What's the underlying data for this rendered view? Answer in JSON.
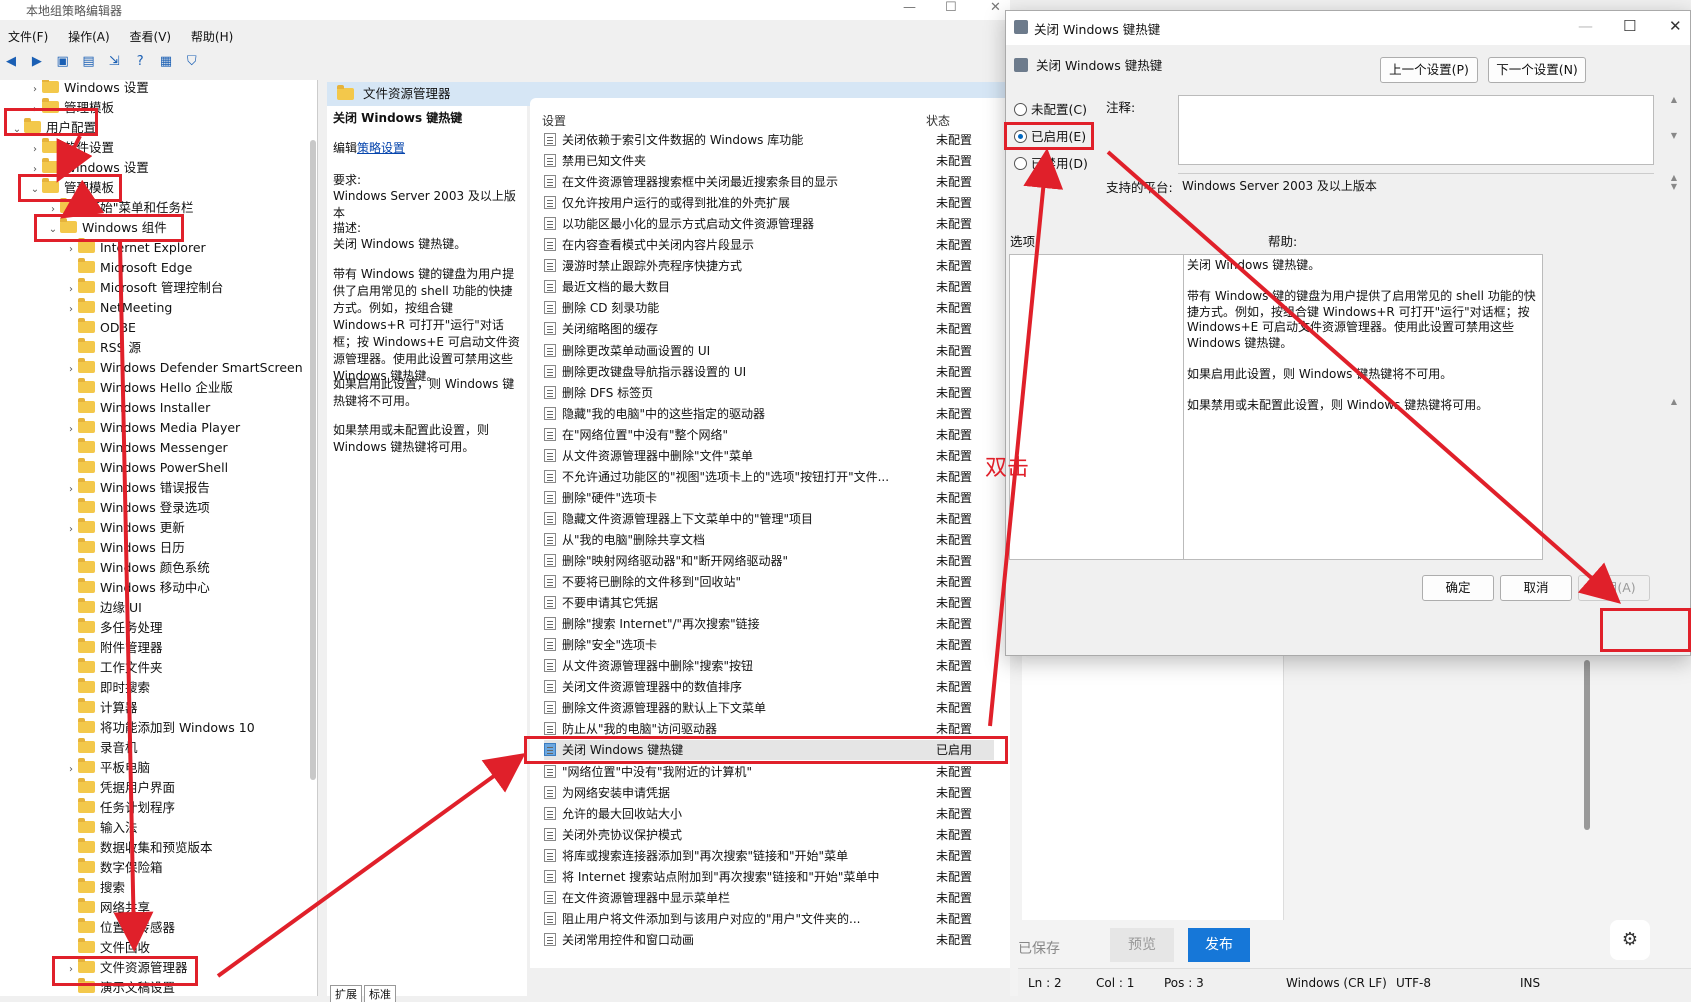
{
  "window": {
    "title": "本地组策略编辑器"
  },
  "menu": [
    "文件(F)",
    "操作(A)",
    "查看(V)",
    "帮助(H)"
  ],
  "toolbar_icons": [
    "back-icon",
    "forward-icon",
    "up-folder-icon",
    "show-hide-icon",
    "export-icon",
    "help-icon",
    "properties-icon",
    "filter-icon"
  ],
  "tree": [
    {
      "label": "Windows 设置",
      "expander": "›"
    },
    {
      "label": "管理模板",
      "expander": "›"
    },
    {
      "label": "用户配置",
      "expander": "⌄"
    },
    {
      "label": "软件设置",
      "expander": "›"
    },
    {
      "label": "Windows 设置",
      "expander": "›"
    },
    {
      "label": "管理模板",
      "expander": "⌄"
    },
    {
      "label": "\"开始\"菜单和任务栏",
      "expander": "›"
    },
    {
      "label": "Windows 组件",
      "expander": "⌄"
    },
    {
      "label": "Internet Explorer",
      "expander": "›"
    },
    {
      "label": "Microsoft Edge",
      "expander": ""
    },
    {
      "label": "Microsoft 管理控制台",
      "expander": "›"
    },
    {
      "label": "NetMeeting",
      "expander": "›"
    },
    {
      "label": "ODBE",
      "expander": ""
    },
    {
      "label": "RSS 源",
      "expander": ""
    },
    {
      "label": "Windows Defender SmartScreen",
      "expander": "›"
    },
    {
      "label": "Windows Hello 企业版",
      "expander": ""
    },
    {
      "label": "Windows Installer",
      "expander": ""
    },
    {
      "label": "Windows Media Player",
      "expander": "›"
    },
    {
      "label": "Windows Messenger",
      "expander": ""
    },
    {
      "label": "Windows PowerShell",
      "expander": ""
    },
    {
      "label": "Windows 错误报告",
      "expander": "›"
    },
    {
      "label": "Windows 登录选项",
      "expander": ""
    },
    {
      "label": "Windows 更新",
      "expander": "›"
    },
    {
      "label": "Windows 日历",
      "expander": ""
    },
    {
      "label": "Windows 颜色系统",
      "expander": ""
    },
    {
      "label": "Windows 移动中心",
      "expander": ""
    },
    {
      "label": "边缘 UI",
      "expander": ""
    },
    {
      "label": "多任务处理",
      "expander": ""
    },
    {
      "label": "附件管理器",
      "expander": ""
    },
    {
      "label": "工作文件夹",
      "expander": ""
    },
    {
      "label": "即时搜索",
      "expander": ""
    },
    {
      "label": "计算器",
      "expander": ""
    },
    {
      "label": "将功能添加到 Windows 10",
      "expander": ""
    },
    {
      "label": "录音机",
      "expander": ""
    },
    {
      "label": "平板电脑",
      "expander": "›"
    },
    {
      "label": "凭据用户界面",
      "expander": ""
    },
    {
      "label": "任务计划程序",
      "expander": ""
    },
    {
      "label": "输入法",
      "expander": ""
    },
    {
      "label": "数据收集和预览版本",
      "expander": ""
    },
    {
      "label": "数字保险箱",
      "expander": ""
    },
    {
      "label": "搜索",
      "expander": ""
    },
    {
      "label": "网络共享",
      "expander": ""
    },
    {
      "label": "位置和传感器",
      "expander": ""
    },
    {
      "label": "文件回收",
      "expander": ""
    },
    {
      "label": "文件资源管理器",
      "expander": "›"
    },
    {
      "label": "演示文稿设置",
      "expander": ""
    }
  ],
  "desc": {
    "header": "文件资源管理器",
    "title": "关闭 Windows 键热键",
    "edit_prefix": "编辑",
    "edit_link": "策略设置",
    "req_label": "要求:",
    "req_value": "Windows Server 2003 及以上版本",
    "desc_label": "描述:",
    "desc_p1": "关闭 Windows 键热键。",
    "desc_p2": "带有 Windows 键的键盘为用户提供了启用常见的 shell 功能的快捷方式。例如，按组合键 Windows+R 可打开\"运行\"对话框；按 Windows+E 可启动文件资源管理器。使用此设置可禁用这些 Windows 键热键。",
    "desc_p3": "如果启用此设置，则 Windows 键热键将不可用。",
    "desc_p4": "如果禁用或未配置此设置，则 Windows 键热键将可用。"
  },
  "settings": {
    "col_setting": "设置",
    "col_state": "状态",
    "rows": [
      {
        "name": "关闭依赖于索引文件数据的 Windows 库功能",
        "state": "未配置"
      },
      {
        "name": "禁用已知文件夹",
        "state": "未配置"
      },
      {
        "name": "在文件资源管理器搜索框中关闭最近搜索条目的显示",
        "state": "未配置"
      },
      {
        "name": "仅允许按用户运行的或得到批准的外壳扩展",
        "state": "未配置"
      },
      {
        "name": "以功能区最小化的显示方式启动文件资源管理器",
        "state": "未配置"
      },
      {
        "name": "在内容查看模式中关闭内容片段显示",
        "state": "未配置"
      },
      {
        "name": "漫游时禁止跟踪外壳程序快捷方式",
        "state": "未配置"
      },
      {
        "name": "最近文档的最大数目",
        "state": "未配置"
      },
      {
        "name": "删除 CD 刻录功能",
        "state": "未配置"
      },
      {
        "name": "关闭缩略图的缓存",
        "state": "未配置"
      },
      {
        "name": "删除更改菜单动画设置的 UI",
        "state": "未配置"
      },
      {
        "name": "删除更改键盘导航指示器设置的 UI",
        "state": "未配置"
      },
      {
        "name": "删除 DFS 标签页",
        "state": "未配置"
      },
      {
        "name": "隐藏\"我的电脑\"中的这些指定的驱动器",
        "state": "未配置"
      },
      {
        "name": "在\"网络位置\"中没有\"整个网络\"",
        "state": "未配置"
      },
      {
        "name": "从文件资源管理器中删除\"文件\"菜单",
        "state": "未配置"
      },
      {
        "name": "不允许通过功能区的\"视图\"选项卡上的\"选项\"按钮打开\"文件...",
        "state": "未配置"
      },
      {
        "name": "删除\"硬件\"选项卡",
        "state": "未配置"
      },
      {
        "name": "隐藏文件资源管理器上下文菜单中的\"管理\"项目",
        "state": "未配置"
      },
      {
        "name": "从\"我的电脑\"删除共享文档",
        "state": "未配置"
      },
      {
        "name": "删除\"映射网络驱动器\"和\"断开网络驱动器\"",
        "state": "未配置"
      },
      {
        "name": "不要将已删除的文件移到\"回收站\"",
        "state": "未配置"
      },
      {
        "name": "不要申请其它凭据",
        "state": "未配置"
      },
      {
        "name": "删除\"搜索 Internet\"/\"再次搜索\"链接",
        "state": "未配置"
      },
      {
        "name": "删除\"安全\"选项卡",
        "state": "未配置"
      },
      {
        "name": "从文件资源管理器中删除\"搜索\"按钮",
        "state": "未配置"
      },
      {
        "name": "关闭文件资源管理器中的数值排序",
        "state": "未配置"
      },
      {
        "name": "删除文件资源管理器的默认上下文菜单",
        "state": "未配置"
      },
      {
        "name": "防止从\"我的电脑\"访问驱动器",
        "state": "未配置"
      },
      {
        "name": "关闭 Windows 键热键",
        "state": "已启用"
      },
      {
        "name": "\"网络位置\"中没有\"我附近的计算机\"",
        "state": "未配置"
      },
      {
        "name": "为网络安装申请凭据",
        "state": "未配置"
      },
      {
        "name": "允许的最大回收站大小",
        "state": "未配置"
      },
      {
        "name": "关闭外壳协议保护模式",
        "state": "未配置"
      },
      {
        "name": "将库或搜索连接器添加到\"再次搜索\"链接和\"开始\"菜单",
        "state": "未配置"
      },
      {
        "name": "将 Internet 搜索站点附加到\"再次搜索\"链接和\"开始\"菜单中",
        "state": "未配置"
      },
      {
        "name": "在文件资源管理器中显示菜单栏",
        "state": "未配置"
      },
      {
        "name": "阻止用户将文件添加到与该用户对应的\"用户\"文件夹的...",
        "state": "未配置"
      },
      {
        "name": "关闭常用控件和窗口动画",
        "state": "未配置"
      }
    ]
  },
  "bottom_tabs": [
    "扩展",
    "标准"
  ],
  "background_app": {
    "saved": "已保存",
    "preview": "预览",
    "publish": "发布"
  },
  "statusbar": {
    "ln": "Ln : 2",
    "col": "Col : 1",
    "pos": "Pos : 3",
    "eol": "Windows (CR LF)",
    "enc": "UTF-8",
    "mode": "INS"
  },
  "dialog": {
    "title": "关闭 Windows 键热键",
    "subtitle": "关闭 Windows 键热键",
    "prev": "上一个设置(P)",
    "next": "下一个设置(N)",
    "radio_not_configured": "未配置(C)",
    "radio_enabled": "已启用(E)",
    "radio_disabled": "已禁用(D)",
    "comment_label": "注释:",
    "platform_label": "支持的平台:",
    "platform_value": "Windows Server 2003 及以上版本",
    "options_label": "选项:",
    "help_label": "帮助:",
    "help_p1": "关闭 Windows 键热键。",
    "help_p2": "带有 Windows 键的键盘为用户提供了启用常见的 shell 功能的快捷方式。例如，按组合键 Windows+R 可打开\"运行\"对话框；按 Windows+E 可启动文件资源管理器。使用此设置可禁用这些 Windows 键热键。",
    "help_p3": "如果启用此设置，则 Windows 键热键将不可用。",
    "help_p4": "如果禁用或未配置此设置，则 Windows 键热键将可用。",
    "ok": "确定",
    "cancel": "取消",
    "apply": "应用(A)"
  },
  "annotation": {
    "double_click": "双击",
    "color": "#e0202a"
  }
}
